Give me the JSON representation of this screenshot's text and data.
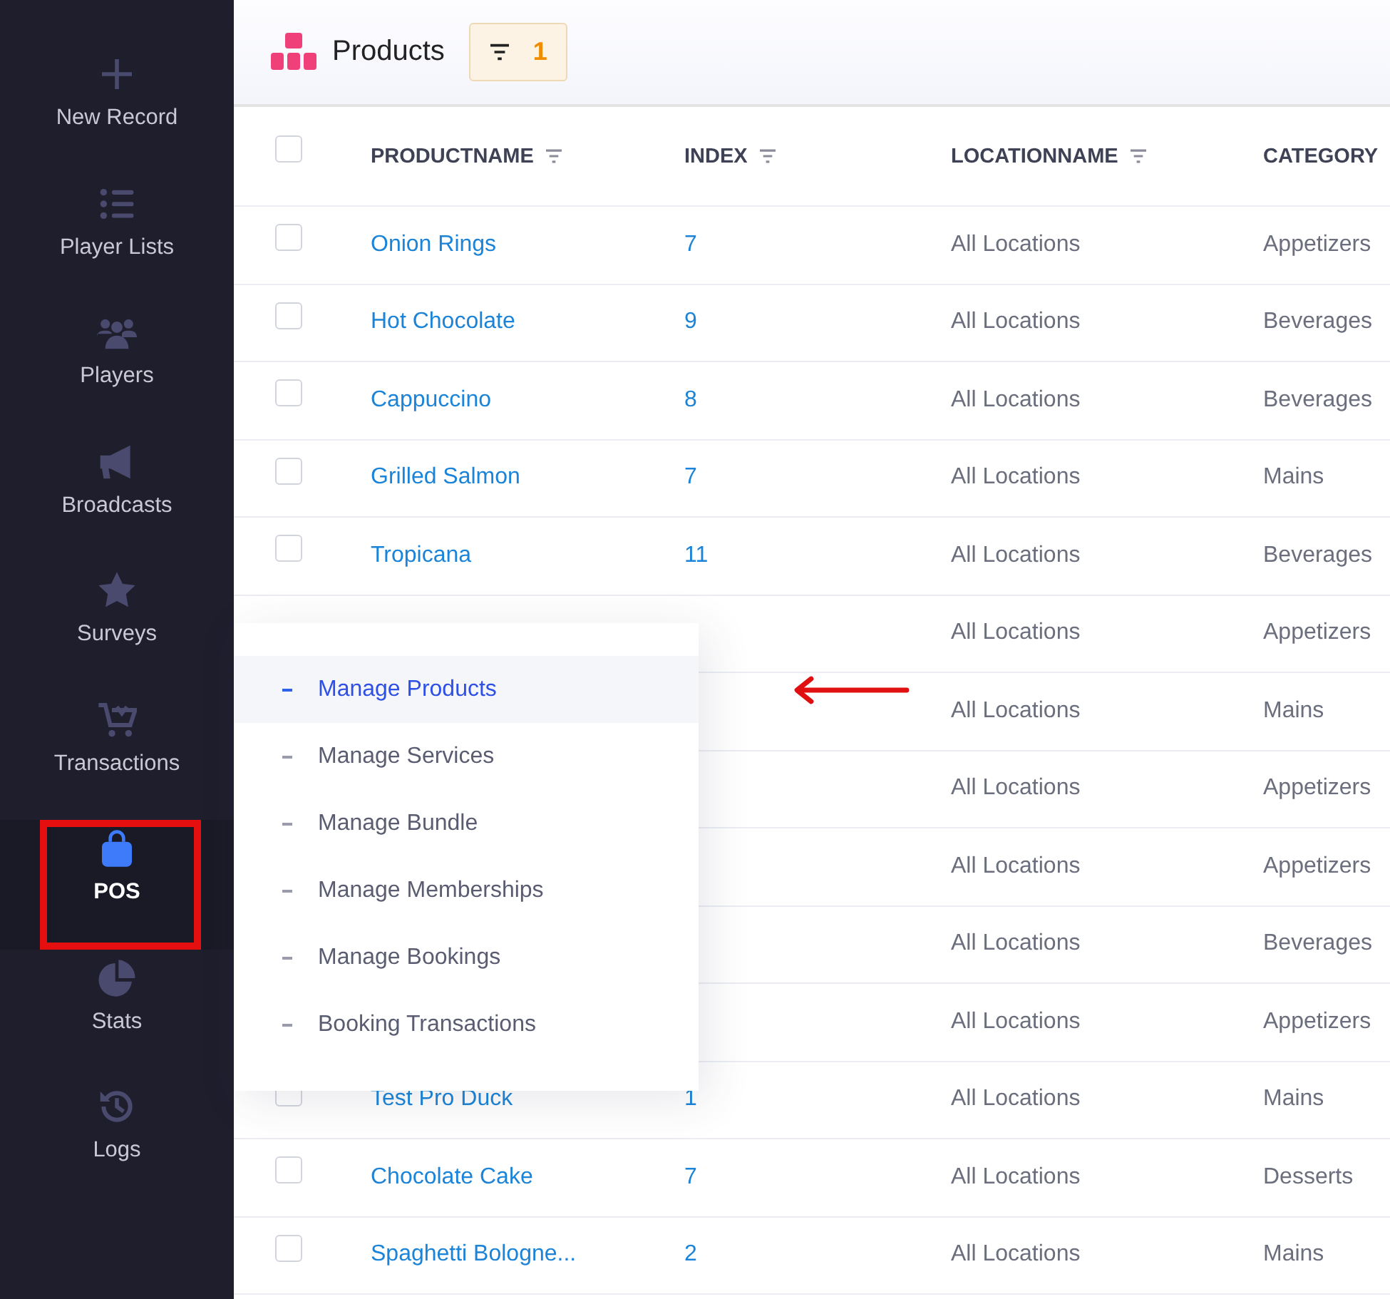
{
  "sidebar": {
    "items": [
      {
        "label": "New Record",
        "selected": false,
        "highlighted": false
      },
      {
        "label": "Player Lists",
        "selected": false,
        "highlighted": false
      },
      {
        "label": "Players",
        "selected": false,
        "highlighted": false
      },
      {
        "label": "Broadcasts",
        "selected": false,
        "highlighted": false
      },
      {
        "label": "Surveys",
        "selected": false,
        "highlighted": false
      },
      {
        "label": "Transactions",
        "selected": false,
        "highlighted": false
      },
      {
        "label": "POS",
        "selected": true,
        "highlighted": true
      },
      {
        "label": "Stats",
        "selected": false,
        "highlighted": false
      },
      {
        "label": "Logs",
        "selected": false,
        "highlighted": false
      }
    ]
  },
  "header": {
    "title": "Products",
    "filter_count": "1"
  },
  "table": {
    "columns": [
      {
        "label": "PRODUCTNAME",
        "filterable": true
      },
      {
        "label": "INDEX",
        "filterable": true
      },
      {
        "label": "LOCATIONNAME",
        "filterable": true
      },
      {
        "label": "CATEGORY",
        "filterable": false
      }
    ],
    "header_checked": false,
    "rows": [
      {
        "checked": false,
        "productname": "Onion Rings",
        "index": "7",
        "locationname": "All Locations",
        "category": "Appetizers"
      },
      {
        "checked": false,
        "productname": "Hot Chocolate",
        "index": "9",
        "locationname": "All Locations",
        "category": "Beverages"
      },
      {
        "checked": false,
        "productname": "Cappuccino",
        "index": "8",
        "locationname": "All Locations",
        "category": "Beverages"
      },
      {
        "checked": false,
        "productname": "Grilled Salmon",
        "index": "7",
        "locationname": "All Locations",
        "category": "Mains"
      },
      {
        "checked": false,
        "productname": "Tropicana",
        "index": "11",
        "locationname": "All Locations",
        "category": "Beverages"
      },
      {
        "locationname": "All Locations",
        "category": "Appetizers"
      },
      {
        "locationname": "All Locations",
        "category": "Mains"
      },
      {
        "locationname": "All Locations",
        "category": "Appetizers"
      },
      {
        "locationname": "All Locations",
        "category": "Appetizers"
      },
      {
        "locationname": "All Locations",
        "category": "Beverages"
      },
      {
        "locationname": "All Locations",
        "category": "Appetizers"
      },
      {
        "checked": false,
        "productname": "Test Pro Duck",
        "index": "1",
        "locationname": "All Locations",
        "category": "Mains"
      },
      {
        "checked": false,
        "productname": "Chocolate Cake",
        "index": "7",
        "locationname": "All Locations",
        "category": "Desserts"
      },
      {
        "checked": false,
        "productname": "Spaghetti Bologne...",
        "index": "2",
        "locationname": "All Locations",
        "category": "Mains"
      }
    ]
  },
  "submenu": {
    "items": [
      {
        "label": "Manage Products",
        "selected": true,
        "pointed": true
      },
      {
        "label": "Manage Services",
        "selected": false,
        "pointed": false
      },
      {
        "label": "Manage Bundle",
        "selected": false,
        "pointed": false
      },
      {
        "label": "Manage Memberships",
        "selected": false,
        "pointed": false
      },
      {
        "label": "Manage Bookings",
        "selected": false,
        "pointed": false
      },
      {
        "label": "Booking Transactions",
        "selected": false,
        "pointed": false
      }
    ]
  }
}
